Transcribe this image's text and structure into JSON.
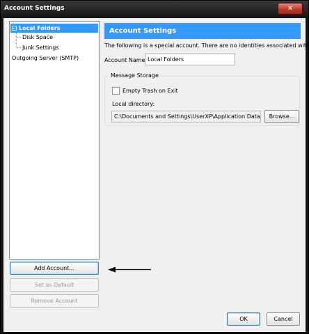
{
  "window": {
    "title": "Account Settings",
    "close_glyph": "✕"
  },
  "tree": {
    "items": [
      {
        "label": "Local Folders"
      },
      {
        "label": "Disk Space"
      },
      {
        "label": "Junk Settings"
      },
      {
        "label": "Outgoing Server (SMTP)"
      }
    ]
  },
  "left_buttons": {
    "add_account": "Add Account...",
    "set_default": "Set as Default",
    "remove_account": "Remove Account"
  },
  "panel": {
    "header": "Account Settings",
    "description": "The following is a special account. There are no identities associated with it.",
    "account_name_label": "Account Name:",
    "account_name_value": "Local Folders",
    "message_storage_legend": "Message Storage",
    "empty_trash_label": "Empty Trash on Exit",
    "local_directory_label": "Local directory:",
    "local_directory_value": "C:\\Documents and Settings\\UserXP\\Application Data\\Thunde",
    "browse_label": "Browse..."
  },
  "footer": {
    "ok_label": "OK",
    "cancel_label": "Cancel"
  },
  "annotation": {
    "arrow_color": "#000000"
  }
}
